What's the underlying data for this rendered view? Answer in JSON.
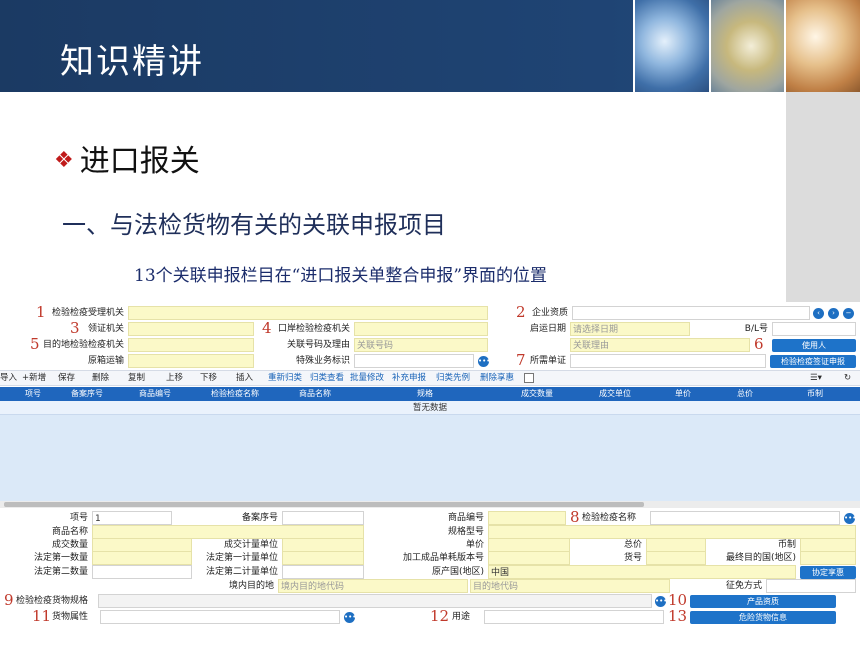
{
  "header": {
    "title": "知识精讲"
  },
  "slide": {
    "heading": "进口报关",
    "diamond": "❖",
    "subheading": "一、与法检货物有关的关联申报项目",
    "caption": "13个关联申报栏目在“进口报关单整合申报”界面的位置"
  },
  "form": {
    "top": {
      "inspection_office": "检验检疫受理机关",
      "permit_office": "领证机关",
      "dest_inspection_office": "目的地检验检疫机关",
      "orig_box_transport": "原箱运输",
      "port_inspection_office": "口岸检验检疫机关",
      "related_no_reason": "关联号码及理由",
      "related_no_placeholder": "关联号码",
      "special_business": "特殊业务标识",
      "enterprise_qualification": "企业资质",
      "departure_date": "启运日期",
      "departure_date_placeholder": "请选择日期",
      "related_reason_placeholder": "关联理由",
      "required_docs": "所需单证",
      "bl_no": "B/L号",
      "user_button": "使用人",
      "cert_button": "检验检疫签证申报"
    },
    "toolbar": {
      "import": "导入",
      "add": "+新增",
      "save": "保存",
      "delete": "删除",
      "copy": "复制",
      "move_up": "上移",
      "move_down": "下移",
      "insert": "插入",
      "reclassify": "重新归类",
      "class_query": "归类查看",
      "batch_edit": "批量修改",
      "supplement": "补充申报",
      "class_precedent": "归类先例",
      "delete_share": "删除享惠"
    },
    "grid": {
      "headers": [
        "项号",
        "备案序号",
        "商品编号",
        "检验检疫名称",
        "商品名称",
        "规格",
        "成交数量",
        "成交单位",
        "单价",
        "总价",
        "币制"
      ],
      "empty": "暂无数据"
    },
    "detail": {
      "item_no": "项号",
      "item_no_value": "1",
      "record_no": "备案序号",
      "goods_code": "商品编号",
      "inspection_name": "检验检疫名称",
      "goods_name": "商品名称",
      "spec": "规格型号",
      "deal_qty": "成交数量",
      "deal_unit": "成交计量单位",
      "unit_price": "单价",
      "total_price": "总价",
      "currency": "币制",
      "legal_qty1": "法定第一数量",
      "legal_unit1": "法定第一计量单位",
      "processed_version": "加工成品单耗版本号",
      "goods_no": "货号",
      "final_dest": "最终目的国(地区)",
      "legal_qty2": "法定第二数量",
      "legal_unit2": "法定第二计量单位",
      "origin": "原产国(地区)",
      "origin_value": "中国",
      "agreement_button": "协定享惠",
      "domestic_dest": "境内目的地",
      "domestic_dest_placeholder": "境内目的地代码",
      "dest_placeholder": "目的地代码",
      "tax_mode": "征免方式",
      "goods_spec": "检验检疫货物规格",
      "product_qual_button": "产品资质",
      "goods_attr": "货物属性",
      "usage": "用途",
      "danger_button": "危险货物信息"
    },
    "numbers": [
      "1",
      "2",
      "3",
      "4",
      "5",
      "6",
      "7",
      "8",
      "9",
      "10",
      "11",
      "12",
      "13"
    ]
  }
}
